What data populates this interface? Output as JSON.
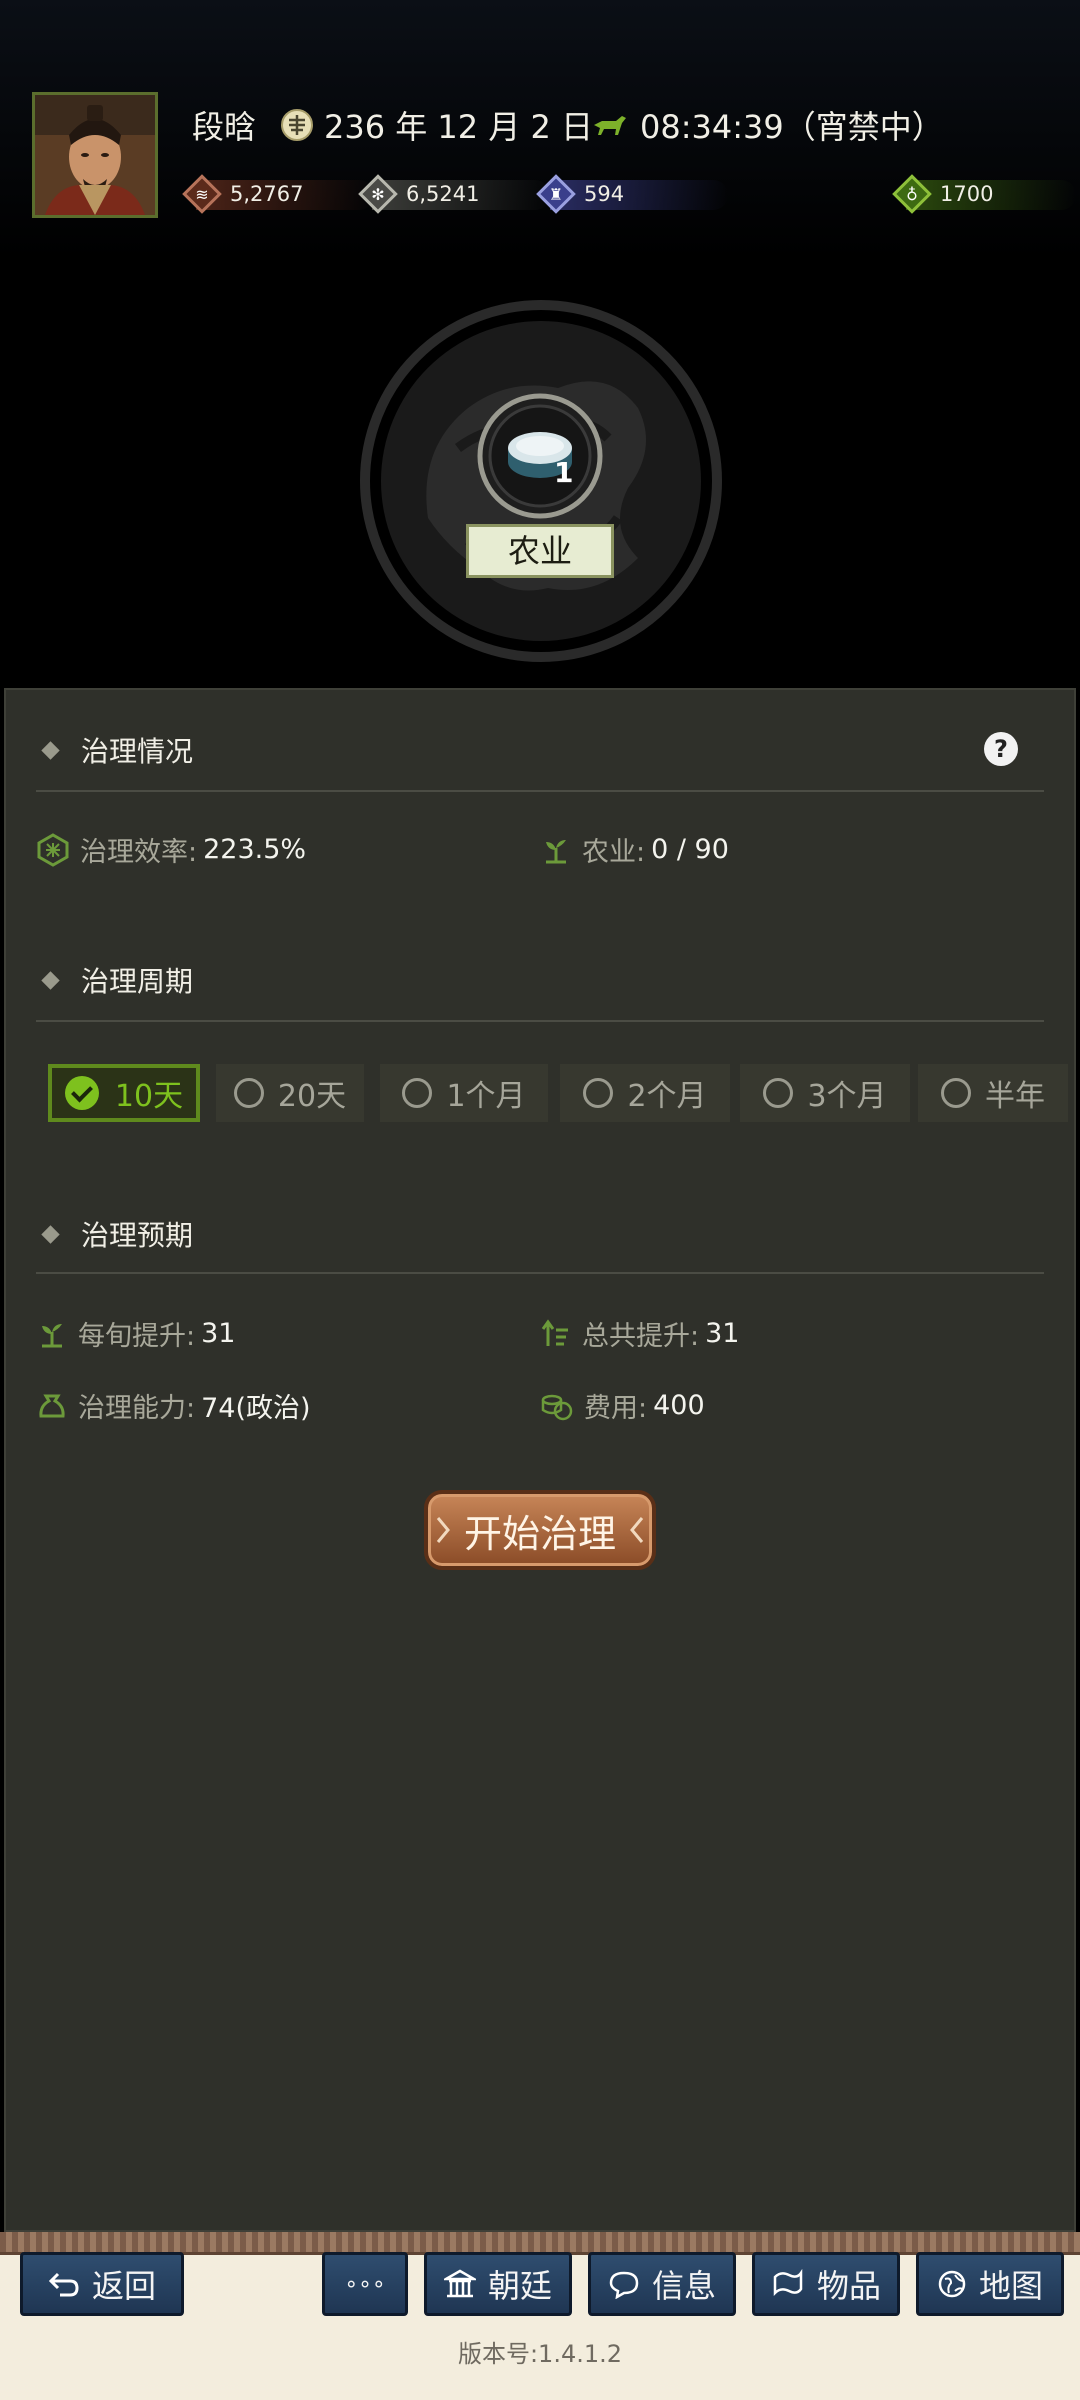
{
  "header": {
    "name": "段晗",
    "date": "236 年 12 月 2 日",
    "time": "08:34:39（宵禁中）",
    "resources": [
      {
        "name": "money",
        "value": "5,2767",
        "icon": "coins-icon",
        "color": "#7a3b24"
      },
      {
        "name": "food",
        "value": "6,5241",
        "icon": "grain-icon",
        "color": "#6a6a64"
      },
      {
        "name": "troops",
        "value": "594",
        "icon": "soldier-icon",
        "color": "#3a3f8c"
      },
      {
        "name": "special",
        "value": "1700",
        "icon": "pouch-icon",
        "color": "#3f6a12"
      }
    ],
    "center_label": "农业",
    "center_count": "1"
  },
  "panel": {
    "section1_title": "治理情况",
    "efficiency_label": "治理效率:",
    "efficiency_value": "223.5%",
    "agri_label": "农业:",
    "agri_value": "0 / 90",
    "section2_title": "治理周期",
    "periods": [
      "10天",
      "20天",
      "1个月",
      "2个月",
      "3个月",
      "半年"
    ],
    "selected_period": "10天",
    "section3_title": "治理预期",
    "per_ten_label": "每旬提升:",
    "per_ten_value": "31",
    "total_label": "总共提升:",
    "total_value": "31",
    "ability_label": "治理能力:",
    "ability_value": "74(政治)",
    "cost_label": "费用:",
    "cost_value": "400",
    "start_button": "开始治理"
  },
  "bottom_nav": {
    "back": "返回",
    "more": "∘∘∘",
    "court": "朝廷",
    "info": "信息",
    "items": "物品",
    "map": "地图"
  },
  "version": "版本号:1.4.1.2"
}
